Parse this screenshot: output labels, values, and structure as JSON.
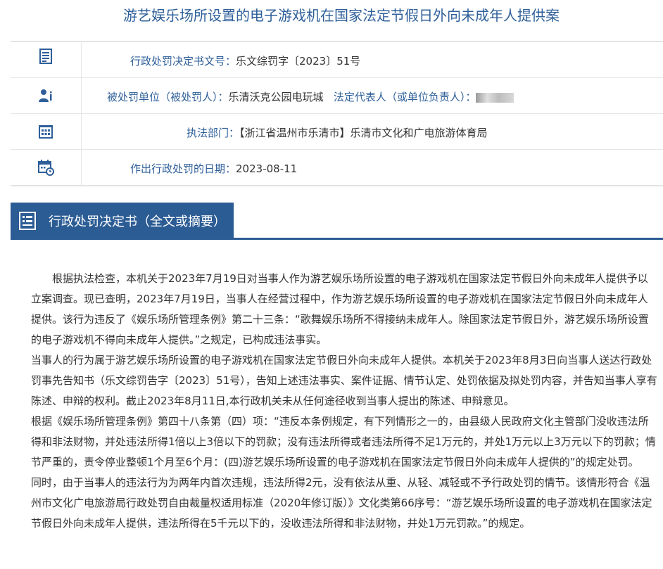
{
  "page": {
    "title": "游艺娱乐场所设置的电子游戏机在国家法定节假日外向未成年人提供案"
  },
  "info": [
    {
      "icon": "document-icon",
      "label": "行政处罚决定书文号：",
      "value": "乐文综罚字〔2023〕51号"
    },
    {
      "icon": "person-icon",
      "label": "被处罚单位（被处罚人）：",
      "value": "乐清沃克公园电玩城",
      "label2": "法定代表人（或单位负责人）：",
      "value2": ""
    },
    {
      "icon": "building-icon",
      "label": "执法部门：",
      "value": "【浙江省温州市乐清市】乐清市文化和广电旅游体育局"
    },
    {
      "icon": "calendar-icon",
      "label": "作出行政处罚的日期：",
      "value": "2023-08-11"
    }
  ],
  "section": {
    "title": "行政处罚决定书（全文或摘要）",
    "icon": "document-list-icon"
  },
  "paragraphs": [
    "根据执法检查，本机关于2023年7月19日对当事人作为游艺娱乐场所设置的电子游戏机在国家法定节假日外向未成年人提供予以立案调查。现已查明，2023年7月19日，当事人在经营过程中，作为游艺娱乐场所设置的电子游戏机在国家法定节假日外向未成年人提供。该行为违反了《娱乐场所管理条例》第二十三条：“歌舞娱乐场所不得接纳未成年人。除国家法定节假日外，游艺娱乐场所设置的电子游戏机不得向未成年人提供。”之规定，已构成违法事实。",
    "当事人的行为属于游艺娱乐场所设置的电子游戏机在国家法定节假日外向未成年人提供。本机关于2023年8月3日向当事人送达行政处罚事先告知书（乐文综罚告字〔2023〕51号），告知上述违法事实、案件证据、情节认定、处罚依据及拟处罚内容，并告知当事人享有陈述、申辩的权利。截止2023年8月11日,本行政机关未从任何途径收到当事人提出的陈述、申辩意见。",
    "根据《娱乐场所管理条例》第四十八条第（四）项：“违反本条例规定，有下列情形之一的，由县级人民政府文化主管部门没收违法所得和非法财物，并处违法所得1倍以上3倍以下的罚款；没有违法所得或者违法所得不足1万元的，并处1万元以上3万元以下的罚款；情节严重的，责令停业整顿1个月至6个月：(四)游艺娱乐场所设置的电子游戏机在国家法定节假日外向未成年人提供的”的规定处罚。",
    "同时，由于当事人的违法行为为两年内首次违规，违法所得2元，没有依法从重、从轻、减轻或不予行政处罚的情节。该情形符合《温州市文化广电旅游局行政处罚自由裁量权适用标准（2020年修订版）》文化类第66序号：“游艺娱乐场所设置的电子游戏机在国家法定节假日外向未成年人提供，违法所得在5千元以下的，没收违法所得和非法财物，并处1万元罚款。”的规定。"
  ]
}
